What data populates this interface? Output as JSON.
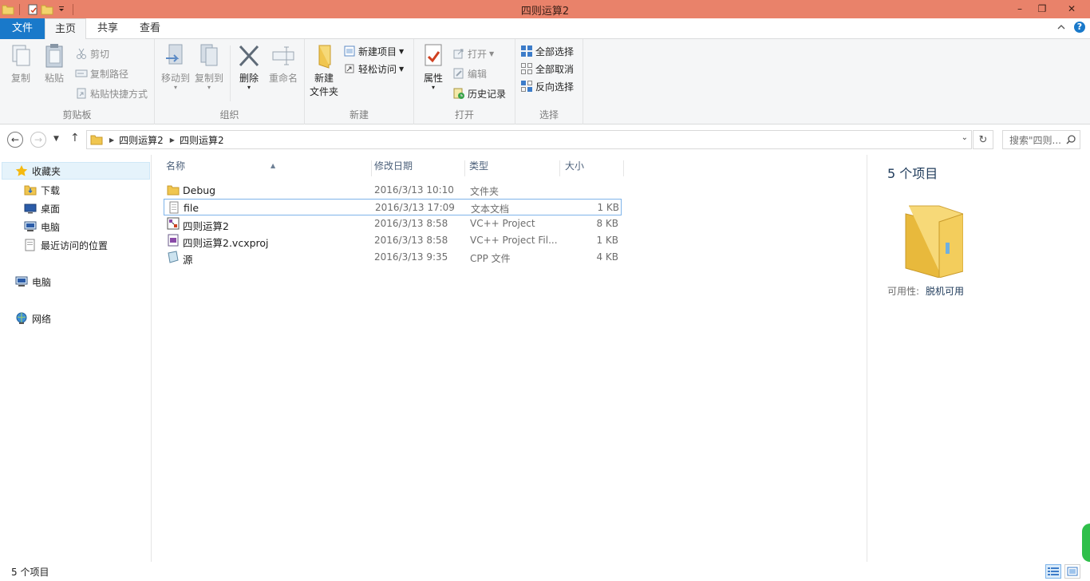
{
  "window": {
    "title": "四则运算2",
    "minimize": "–",
    "maximize": "❐",
    "close": "✕"
  },
  "tabs": {
    "file": "文件",
    "home": "主页",
    "share": "共享",
    "view": "查看"
  },
  "ribbon": {
    "clipboard": {
      "label": "剪贴板",
      "copy": "复制",
      "paste": "粘贴",
      "cut": "剪切",
      "copy_path": "复制路径",
      "paste_shortcut": "粘贴快捷方式"
    },
    "organize": {
      "label": "组织",
      "move_to": "移动到",
      "copy_to": "复制到",
      "delete": "删除",
      "rename": "重命名"
    },
    "new": {
      "label": "新建",
      "new_folder_line1": "新建",
      "new_folder_line2": "文件夹",
      "new_item": "新建项目",
      "easy_access": "轻松访问"
    },
    "open": {
      "label": "打开",
      "properties": "属性",
      "open": "打开",
      "edit": "编辑",
      "history": "历史记录"
    },
    "select": {
      "label": "选择",
      "select_all": "全部选择",
      "select_none": "全部取消",
      "invert": "反向选择"
    }
  },
  "address": {
    "crumbs": [
      "四则运算2",
      "四则运算2"
    ],
    "search_placeholder": "搜索\"四则..."
  },
  "navpane": {
    "favorites": "收藏夹",
    "downloads": "下载",
    "desktop": "桌面",
    "computer_fav": "电脑",
    "recent": "最近访问的位置",
    "computer": "电脑",
    "network": "网络"
  },
  "columns": {
    "name": "名称",
    "date": "修改日期",
    "type": "类型",
    "size": "大小"
  },
  "files": [
    {
      "name": "Debug",
      "date": "2016/3/13 10:10",
      "type": "文件夹",
      "size": "",
      "icon": "folder-icon"
    },
    {
      "name": "file",
      "date": "2016/3/13 17:09",
      "type": "文本文档",
      "size": "1 KB",
      "icon": "text-file-icon"
    },
    {
      "name": "四则运算2",
      "date": "2016/3/13 8:58",
      "type": "VC++ Project",
      "size": "8 KB",
      "icon": "vc-project-icon"
    },
    {
      "name": "四则运算2.vcxproj",
      "date": "2016/3/13 8:58",
      "type": "VC++ Project Fil...",
      "size": "1 KB",
      "icon": "vcxproj-file-icon"
    },
    {
      "name": "源",
      "date": "2016/3/13 9:35",
      "type": "CPP 文件",
      "size": "4 KB",
      "icon": "cpp-file-icon"
    }
  ],
  "details": {
    "count": "5 个项目",
    "availability_label": "可用性:",
    "availability_value": "脱机可用"
  },
  "status": {
    "count": "5 个项目"
  },
  "colors": {
    "titlebar": "#e9826a",
    "file_tab": "#1979ca",
    "selection": "#e5f3fb"
  }
}
